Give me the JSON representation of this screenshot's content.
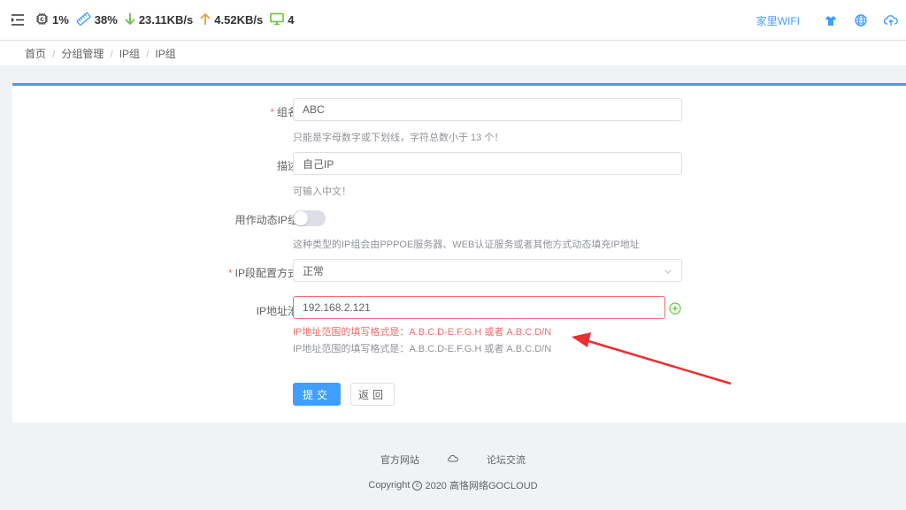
{
  "topbar": {
    "cpu": "1%",
    "memory": "38%",
    "download": "23.11KB/s",
    "upload": "4.52KB/s",
    "devices": "4",
    "wifi_name": "家里WIFI",
    "colors": {
      "accent": "#409eff",
      "download": "#67c23a",
      "upload": "#e6a23c",
      "device": "#67c23a"
    }
  },
  "breadcrumb": [
    "首页",
    "分组管理",
    "IP组",
    "IP组"
  ],
  "form": {
    "group_name": {
      "label": "组名",
      "value": "ABC",
      "hint": "只能是字母数字或下划线，字符总数小于 13 个！"
    },
    "description": {
      "label": "描述",
      "value": "自己IP",
      "hint": "可输入中文！"
    },
    "dynamic": {
      "label": "用作动态IP组",
      "on": false,
      "hint": "这种类型的IP组会由PPPOE服务器、WEB认证服务或者其他方式动态填充IP地址"
    },
    "ip_mode": {
      "label": "IP段配置方式",
      "value": "正常"
    },
    "ip_pool": {
      "label": "IP地址池",
      "value": "192.168.2.121",
      "error": "IP地址范围的填写格式是：A.B.C.D-E.F.G.H 或者 A.B.C.D/N",
      "hint": "IP地址范围的填写格式是：A.B.C.D-E.F.G.H 或者 A.B.C.D/N"
    },
    "submit_label": "提交",
    "back_label": "返回"
  },
  "footer": {
    "links": [
      "官方网站",
      "论坛交流"
    ],
    "copyright_prefix": "Copyright",
    "copyright_suffix": "2020 高恪网络GOCLOUD"
  }
}
